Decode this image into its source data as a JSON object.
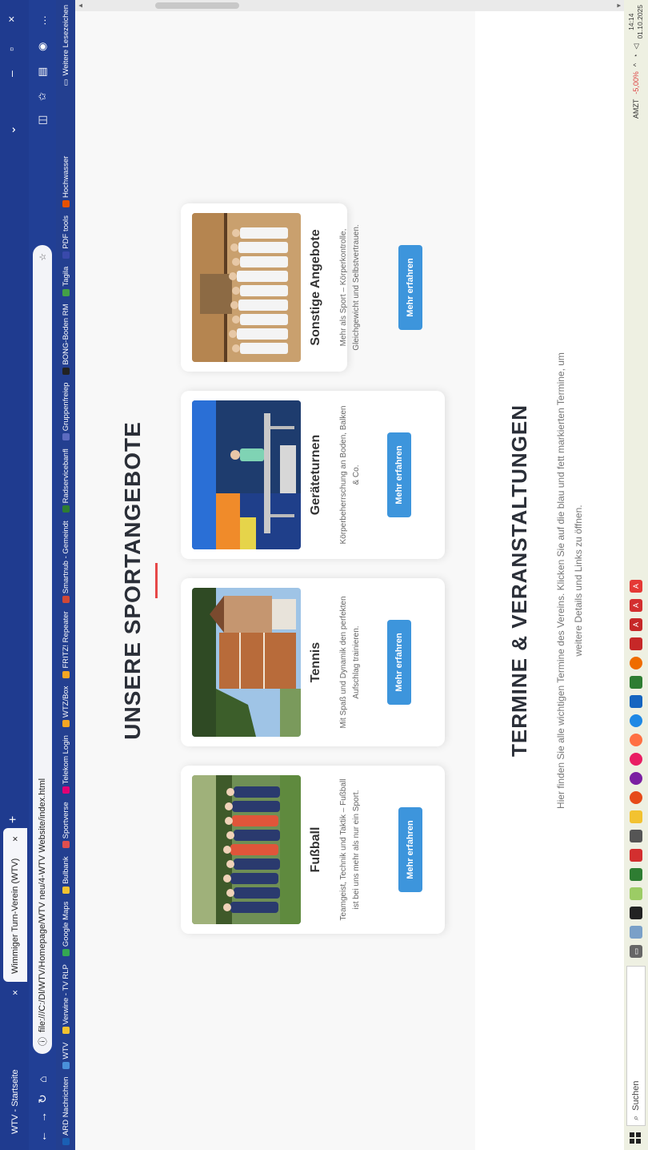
{
  "browser": {
    "tabs": [
      {
        "label": "WTV - Startseite"
      },
      {
        "label": "Wimmiger Turn-Verein (WTV)"
      }
    ],
    "address": "file:///C:/Dl/WTV/Homepage/WTV neu/4-WTV Website/index.html",
    "bookmarks": [
      {
        "label": "ARD Nachrichten",
        "color": "#1a5fb4"
      },
      {
        "label": "WTV",
        "color": "#4a90d9"
      },
      {
        "label": "Verwine - TV RLP",
        "color": "#f2c230"
      },
      {
        "label": "Google Maps",
        "color": "#34a853"
      },
      {
        "label": "Bulbank",
        "color": "#f2c230"
      },
      {
        "label": "Sportverse",
        "color": "#e04f4f"
      },
      {
        "label": "Telekom Login",
        "color": "#e20074"
      },
      {
        "label": "WTZ/Box",
        "color": "#f5a623"
      },
      {
        "label": "FRITZ! Repeater",
        "color": "#f5a623"
      },
      {
        "label": "Smartnub - Gemeindt",
        "color": "#d14836"
      },
      {
        "label": "Radservicebanfl",
        "color": "#2e7d32"
      },
      {
        "label": "Gruppenfreiep",
        "color": "#5c6bc0"
      },
      {
        "label": "BONG-Boden RM",
        "color": "#222222"
      },
      {
        "label": "Tagila",
        "color": "#43a047"
      },
      {
        "label": "PDF tools",
        "color": "#3949ab"
      },
      {
        "label": "Hochwasser",
        "color": "#e65100"
      }
    ],
    "bookmarks_other": "Weitere Lesezeichen"
  },
  "sport_section": {
    "title": "UNSERE SPORTANGEBOTE",
    "cards": [
      {
        "title": "Fußball",
        "desc": "Teamgeist, Technik und Taktik – Fußball ist bei uns mehr als nur ein Sport.",
        "button": "Mehr erfahren",
        "image": "team-photo-football"
      },
      {
        "title": "Tennis",
        "desc": "Mit Spaß und Dynamik den perfekten Aufschlag trainieren.",
        "button": "Mehr erfahren",
        "image": "tennis-court-photo"
      },
      {
        "title": "Geräteturnen",
        "desc": "Körperbeherrschung an Boden, Balken & Co.",
        "button": "Mehr erfahren",
        "image": "gymnastics-hall-photo"
      },
      {
        "title": "Sonstige Angebote",
        "desc": "Mehr als Sport – Körperkontrolle, Gleichgewicht und Selbstvertrauen.",
        "button": "Mehr erfahren",
        "image": "martial-arts-group-photo"
      }
    ]
  },
  "termine_section": {
    "title": "TERMINE & VERANSTALTUNGEN",
    "text": "Hier finden Sie alle wichtigen Termine des Vereins. Klicken Sie auf die blau und fett markierten Termine, um weitere Details und Links zu öffnen."
  },
  "taskbar": {
    "search_placeholder": "Suchen",
    "ticker_label": "AMZT",
    "ticker_value": "-5,00%",
    "time": "14:14",
    "date": "01.10.2025"
  },
  "colors": {
    "accent": "#3d95dc",
    "underline": "#e64848",
    "chrome": "#1f3b8f"
  }
}
